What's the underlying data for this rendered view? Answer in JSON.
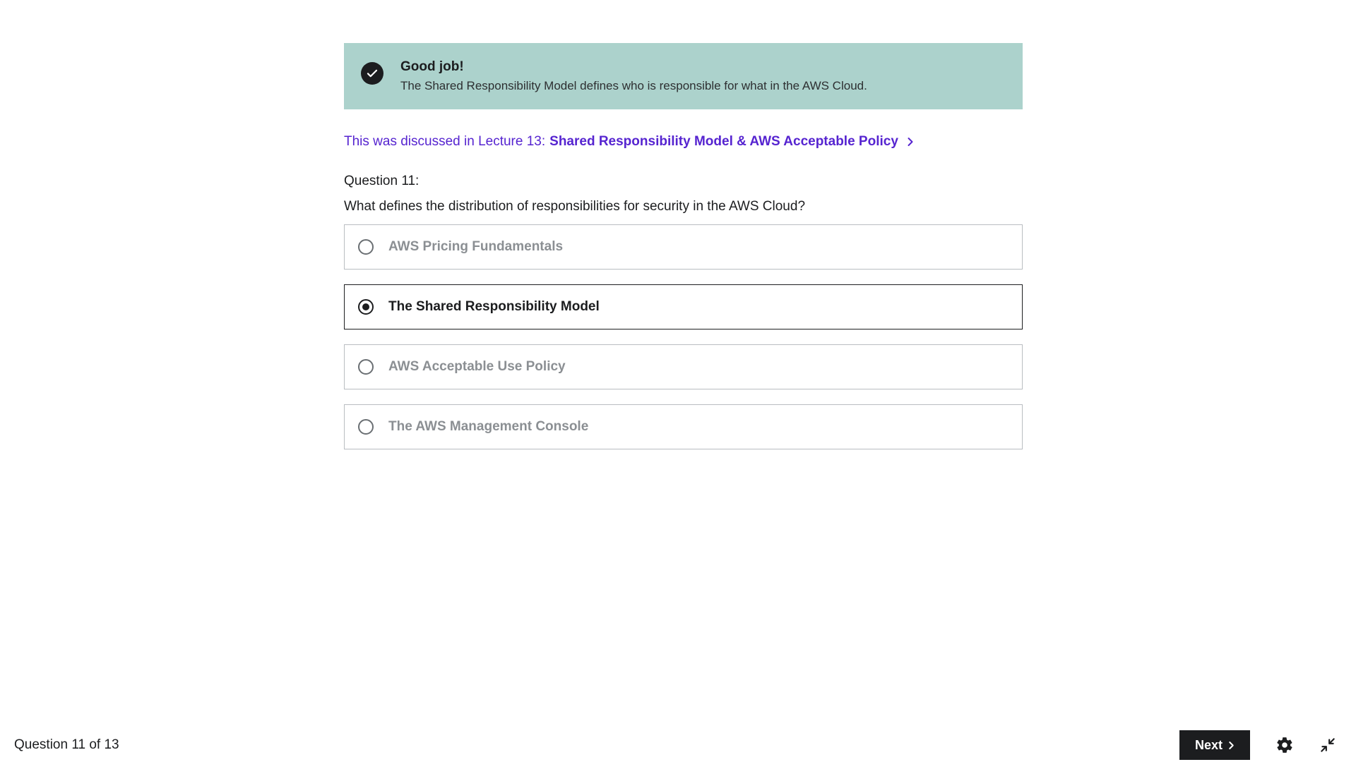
{
  "alert": {
    "icon": "check-circle-icon",
    "title": "Good job!",
    "body": "The Shared Responsibility Model defines who is responsible for what in the AWS Cloud.",
    "background": "#acd2cc"
  },
  "lecture_ref": {
    "prefix": "This was discussed in Lecture 13:",
    "title": "Shared Responsibility Model & AWS Acceptable Policy",
    "icon": "chevron-right-icon",
    "color": "#5624d0"
  },
  "question": {
    "number_label": "Question 11:",
    "text": "What defines the distribution of responsibilities for security in the AWS Cloud?",
    "answers": [
      {
        "label": "AWS Pricing Fundamentals",
        "selected": false
      },
      {
        "label": "The Shared Responsibility Model",
        "selected": true
      },
      {
        "label": "AWS Acceptable Use Policy",
        "selected": false
      },
      {
        "label": "The AWS Management Console",
        "selected": false
      }
    ]
  },
  "footer": {
    "progress": "Question 11 of 13",
    "next_label": "Next",
    "next_icon": "chevron-right-icon",
    "settings_icon": "gear-icon",
    "collapse_icon": "collapse-icon"
  }
}
